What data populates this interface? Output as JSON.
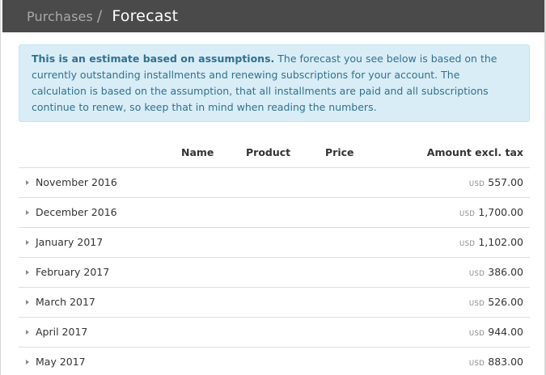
{
  "header": {
    "breadcrumb_parent": "Purchases",
    "breadcrumb_separator": "/",
    "page_title": "Forecast",
    "background_color": "#4a4a4a"
  },
  "notice": {
    "bold_text": "This is an estimate based on assumptions.",
    "body_text": " The forecast you see below is based on the currently outstanding installments and renewing subscriptions for your account. The calculation is based on the assumption, that all installments are paid and all subscriptions continue to renew, so keep that in mind when reading the numbers.",
    "background_color": "#d9edf7",
    "text_color": "#31708f"
  },
  "table": {
    "columns": {
      "name": "Name",
      "product": "Product",
      "price": "Price",
      "amount": "Amount excl. tax"
    },
    "rows": [
      {
        "month": "November 2016",
        "currency": "USD",
        "amount": "557.00"
      },
      {
        "month": "December 2016",
        "currency": "USD",
        "amount": "1,700.00"
      },
      {
        "month": "January 2017",
        "currency": "USD",
        "amount": "1,102.00"
      },
      {
        "month": "February 2017",
        "currency": "USD",
        "amount": "386.00"
      },
      {
        "month": "March 2017",
        "currency": "USD",
        "amount": "526.00"
      },
      {
        "month": "April 2017",
        "currency": "USD",
        "amount": "944.00"
      },
      {
        "month": "May 2017",
        "currency": "USD",
        "amount": "883.00"
      }
    ],
    "expand_icon": "caret-right-icon"
  }
}
